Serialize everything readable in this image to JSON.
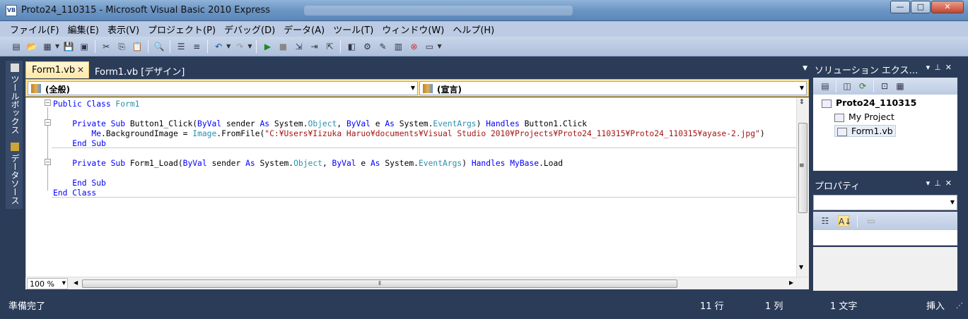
{
  "window": {
    "title": "Proto24_110315 - Microsoft Visual Basic 2010 Express",
    "icon_label": "VB",
    "buttons": {
      "minimize": "—",
      "maximize": "□",
      "close": "✕"
    }
  },
  "menu": [
    "ファイル(F)",
    "編集(E)",
    "表示(V)",
    "プロジェクト(P)",
    "デバッグ(D)",
    "データ(A)",
    "ツール(T)",
    "ウィンドウ(W)",
    "ヘルプ(H)"
  ],
  "side_tabs": {
    "toolbox": "ツールボックス",
    "datasource": "データソース"
  },
  "doc_tabs": {
    "active": "Form1.vb",
    "other": "Form1.vb [デザイン]",
    "close_glyph": "✕"
  },
  "nav": {
    "left": "(全般)",
    "right": "(宣言)"
  },
  "code_lines": [
    {
      "parts": [
        {
          "t": "Public Class ",
          "c": "kw"
        },
        {
          "t": "Form1",
          "c": "ty"
        }
      ]
    },
    {
      "parts": []
    },
    {
      "parts": [
        {
          "t": "    Private Sub ",
          "c": "kw"
        },
        {
          "t": "Button1_Click(",
          "c": ""
        },
        {
          "t": "ByVal",
          "c": "kw"
        },
        {
          "t": " sender ",
          "c": ""
        },
        {
          "t": "As",
          "c": "kw"
        },
        {
          "t": " System.",
          "c": ""
        },
        {
          "t": "Object",
          "c": "ty"
        },
        {
          "t": ", ",
          "c": ""
        },
        {
          "t": "ByVal",
          "c": "kw"
        },
        {
          "t": " e ",
          "c": ""
        },
        {
          "t": "As",
          "c": "kw"
        },
        {
          "t": " System.",
          "c": ""
        },
        {
          "t": "EventArgs",
          "c": "ty"
        },
        {
          "t": ") ",
          "c": ""
        },
        {
          "t": "Handles",
          "c": "kw"
        },
        {
          "t": " Button1.Click",
          "c": ""
        }
      ]
    },
    {
      "parts": [
        {
          "t": "        ",
          "c": ""
        },
        {
          "t": "Me",
          "c": "kw"
        },
        {
          "t": ".BackgroundImage = ",
          "c": ""
        },
        {
          "t": "Image",
          "c": "ty"
        },
        {
          "t": ".FromFile(",
          "c": ""
        },
        {
          "t": "\"C:¥Users¥Iizuka Haruo¥documents¥Visual Studio 2010¥Projects¥Proto24_110315¥Proto24_110315¥ayase-2.jpg\"",
          "c": "st"
        },
        {
          "t": ")",
          "c": ""
        }
      ]
    },
    {
      "parts": [
        {
          "t": "    End Sub",
          "c": "kw"
        }
      ]
    },
    {
      "parts": []
    },
    {
      "parts": [
        {
          "t": "    Private Sub ",
          "c": "kw"
        },
        {
          "t": "Form1_Load(",
          "c": ""
        },
        {
          "t": "ByVal",
          "c": "kw"
        },
        {
          "t": " sender ",
          "c": ""
        },
        {
          "t": "As",
          "c": "kw"
        },
        {
          "t": " System.",
          "c": ""
        },
        {
          "t": "Object",
          "c": "ty"
        },
        {
          "t": ", ",
          "c": ""
        },
        {
          "t": "ByVal",
          "c": "kw"
        },
        {
          "t": " e ",
          "c": ""
        },
        {
          "t": "As",
          "c": "kw"
        },
        {
          "t": " System.",
          "c": ""
        },
        {
          "t": "EventArgs",
          "c": "ty"
        },
        {
          "t": ") ",
          "c": ""
        },
        {
          "t": "Handles",
          "c": "kw"
        },
        {
          "t": " ",
          "c": ""
        },
        {
          "t": "MyBase",
          "c": "kw"
        },
        {
          "t": ".Load",
          "c": ""
        }
      ]
    },
    {
      "parts": []
    },
    {
      "parts": [
        {
          "t": "    End Sub",
          "c": "kw"
        }
      ]
    },
    {
      "parts": [
        {
          "t": "End Class",
          "c": "kw"
        }
      ]
    }
  ],
  "zoom": "100 %",
  "solution_explorer": {
    "title": "ソリューション エクス…",
    "project": "Proto24_110315",
    "items": [
      "My Project",
      "Form1.vb"
    ]
  },
  "properties": {
    "title": "プロパティ"
  },
  "status": {
    "ready": "準備完了",
    "line": "11 行",
    "col": "1 列",
    "char": "1 文字",
    "mode": "挿入"
  }
}
